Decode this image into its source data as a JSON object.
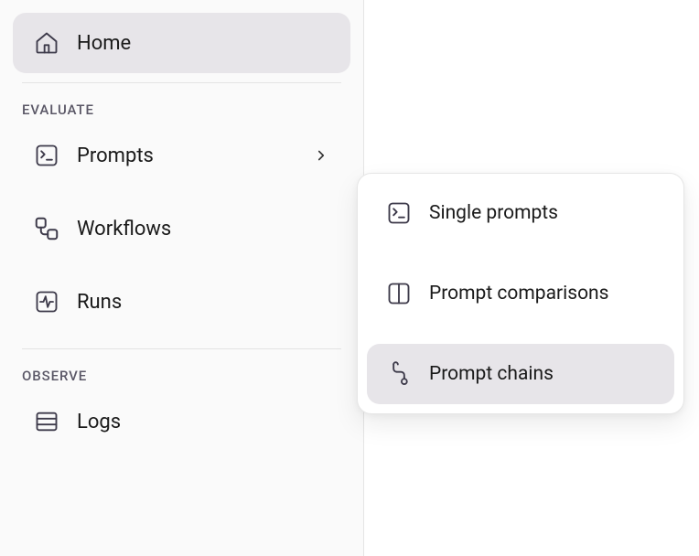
{
  "sidebar": {
    "home_label": "Home",
    "sections": [
      {
        "label": "EVALUATE",
        "items": [
          {
            "label": "Prompts",
            "has_submenu": true
          },
          {
            "label": "Workflows"
          },
          {
            "label": "Runs"
          }
        ]
      },
      {
        "label": "OBSERVE",
        "items": [
          {
            "label": "Logs"
          }
        ]
      }
    ]
  },
  "submenu": {
    "items": [
      {
        "label": "Single prompts"
      },
      {
        "label": "Prompt comparisons"
      },
      {
        "label": "Prompt chains",
        "active": true
      }
    ]
  }
}
